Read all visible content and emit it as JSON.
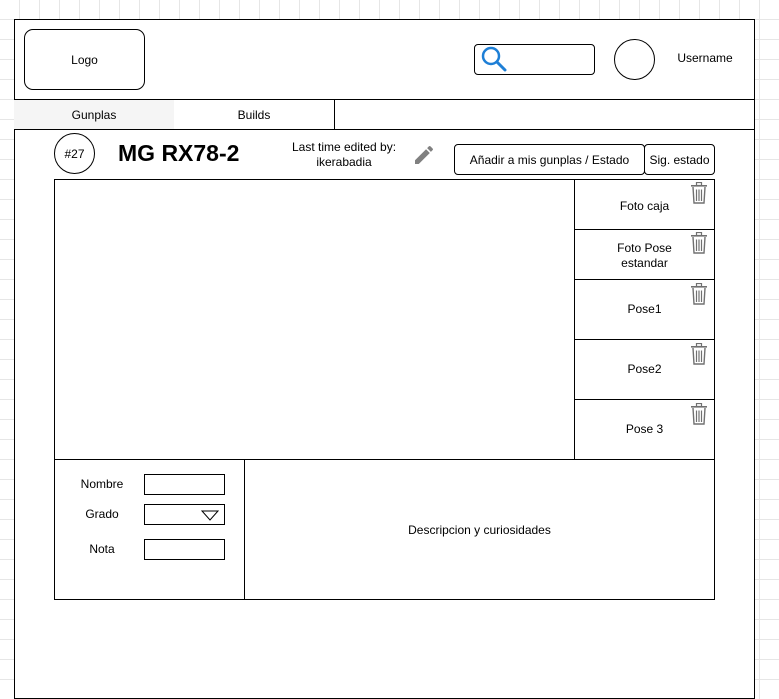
{
  "header": {
    "logo": "Logo",
    "search": {
      "value": "",
      "placeholder": ""
    },
    "username": "Username"
  },
  "tabs": [
    {
      "label": "Gunplas",
      "active": true
    },
    {
      "label": "Builds",
      "active": false
    }
  ],
  "gunpla": {
    "number": "#27",
    "title": "MG RX78-2",
    "edited_label": "Last time edited by:",
    "edited_user": "ikerabadia",
    "add_button": "Añadir a mis gunplas / Estado",
    "next_state_button": "Sig. estado"
  },
  "gallery": {
    "thumbnails": [
      {
        "label": "Foto caja"
      },
      {
        "label": "Foto Pose estandar"
      },
      {
        "label": "Pose1"
      },
      {
        "label": "Pose2"
      },
      {
        "label": "Pose 3"
      }
    ]
  },
  "form": {
    "name_label": "Nombre",
    "name_value": "",
    "grade_label": "Grado",
    "grade_value": "",
    "note_label": "Nota",
    "note_value": ""
  },
  "description": "Descripcion y curiosidades"
}
